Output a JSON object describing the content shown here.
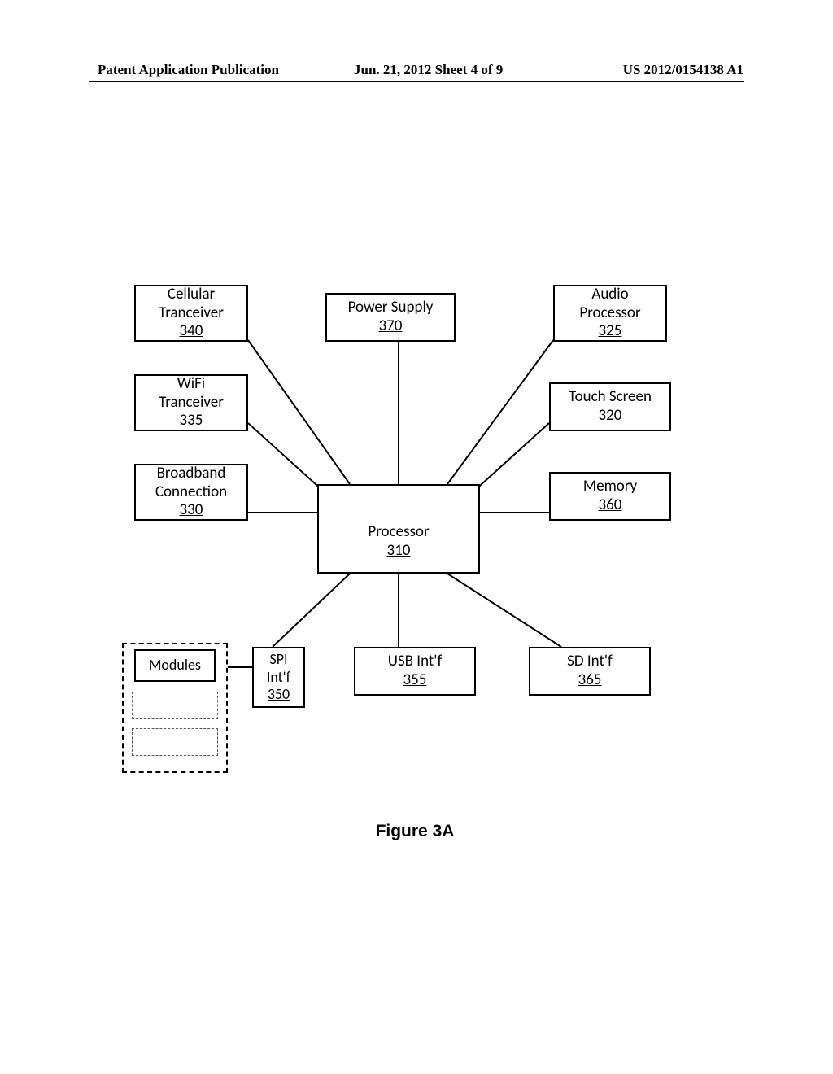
{
  "header": {
    "left": "Patent Application Publication",
    "mid": "Jun. 21, 2012  Sheet 4 of 9",
    "right": "US 2012/0154138 A1"
  },
  "boxes": {
    "cellular": {
      "l1": "Cellular",
      "l2": "Tranceiver",
      "num": "340"
    },
    "power": {
      "l1": "Power Supply",
      "num": "370"
    },
    "audio": {
      "l1": "Audio",
      "l2": "Processor",
      "num": "325"
    },
    "wifi": {
      "l1": "WiFi",
      "l2": "Tranceiver",
      "num": "335"
    },
    "touch": {
      "l1": "Touch Screen",
      "num": "320"
    },
    "broadband": {
      "l1": "Broadband",
      "l2": "Connection",
      "num": "330"
    },
    "memory": {
      "l1": "Memory",
      "num": "360"
    },
    "processor": {
      "l1": "Processor",
      "num": "310"
    },
    "modules": {
      "l1": "Modules"
    },
    "spi": {
      "l1": "SPI",
      "l2": "Int'f",
      "num": "350"
    },
    "usb": {
      "l1": "USB Int'f",
      "num": "355"
    },
    "sd": {
      "l1": "SD Int'f",
      "num": "365"
    }
  },
  "caption": "Figure 3A"
}
